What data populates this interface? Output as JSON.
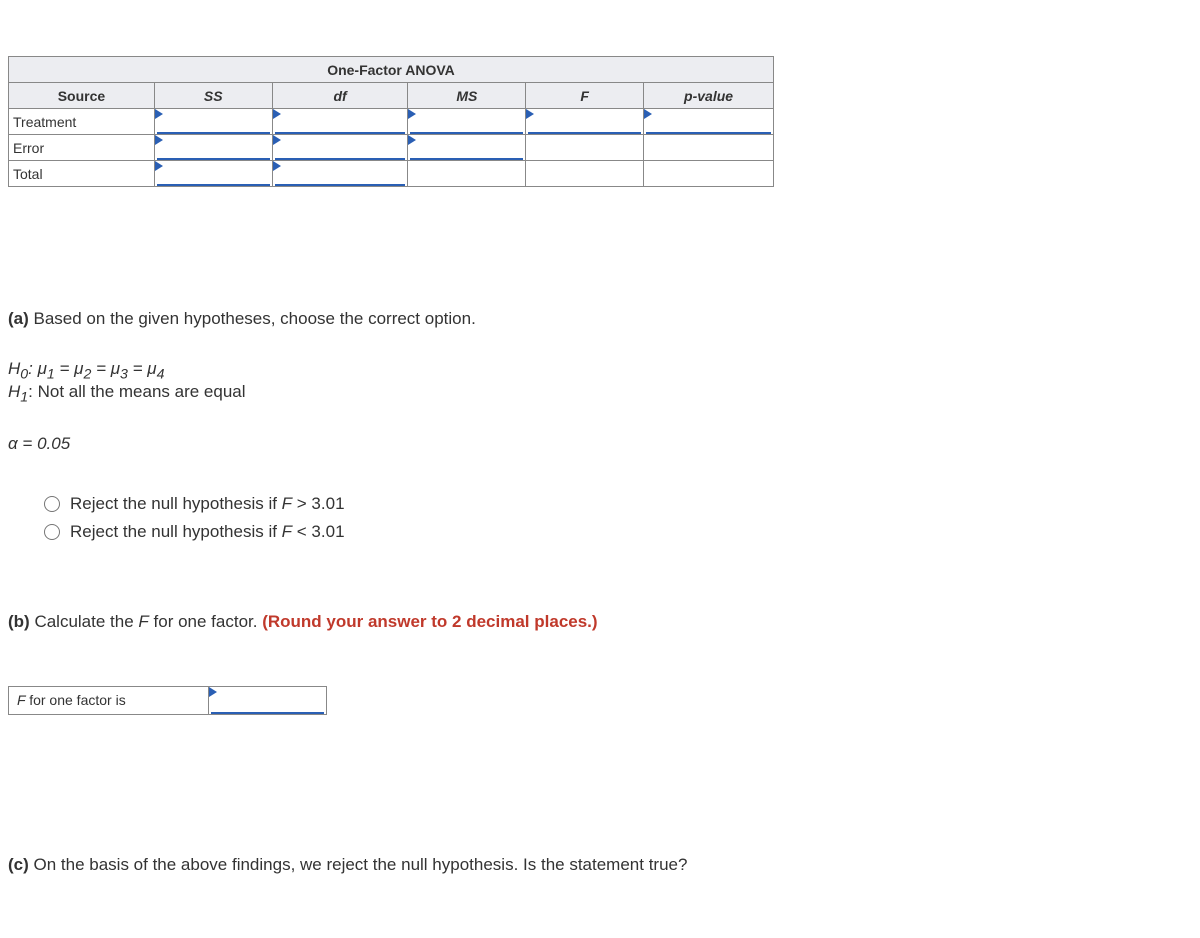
{
  "table": {
    "title": "One-Factor ANOVA",
    "headers": [
      "Source",
      "SS",
      "df",
      "MS",
      "F",
      "p-value"
    ],
    "rows": [
      "Treatment",
      "Error",
      "Total"
    ]
  },
  "partA": {
    "label": "(a)",
    "text": " Based on the given hypotheses, choose the correct option.",
    "h0_prefix": "H",
    "h0_sub": "0",
    "h0_rest": ": μ",
    "mu1": "1",
    "eq": " = μ",
    "mu2": "2",
    "mu3": "3",
    "mu4": "4",
    "h1_prefix": "H",
    "h1_sub": "1",
    "h1_rest": ": Not all the means are equal",
    "alpha": "α = 0.05",
    "opt1": "Reject the null hypothesis if F > 3.01",
    "opt2": "Reject the null hypothesis if F < 3.01"
  },
  "partB": {
    "label": "(b)",
    "text": " Calculate the F for one factor. ",
    "hint": "(Round your answer to 2 decimal places.)",
    "boxLabel": "F for one factor is"
  },
  "partC": {
    "label": "(c)",
    "text": " On the basis of the above findings, we reject the null hypothesis. Is the statement true?"
  }
}
